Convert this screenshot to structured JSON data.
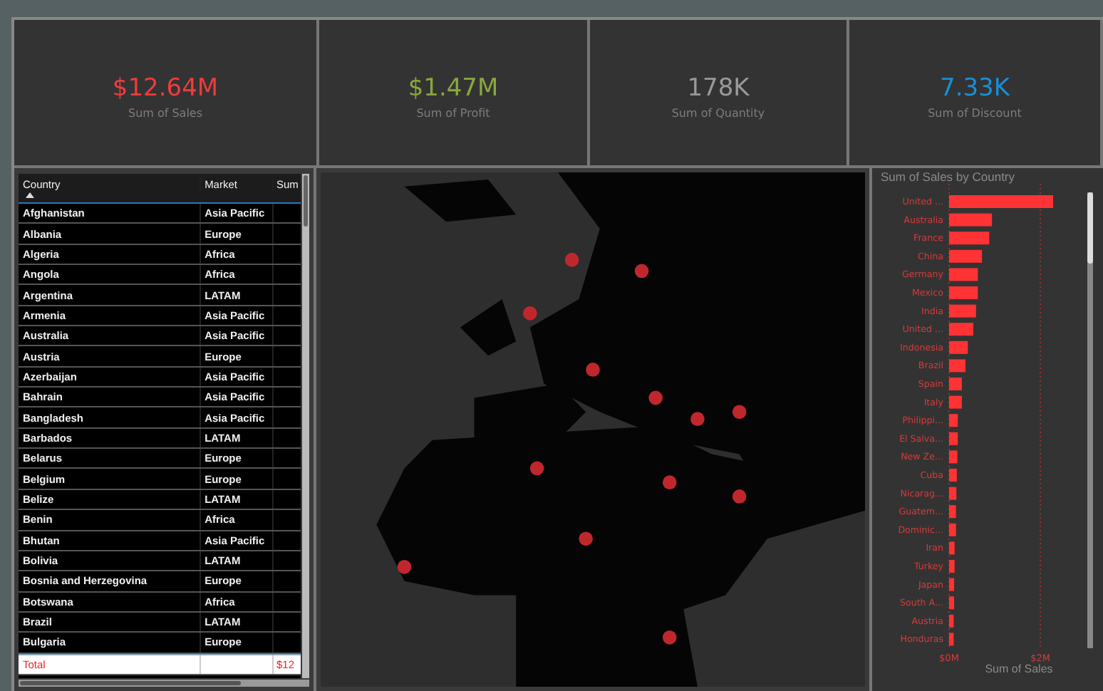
{
  "cards": [
    {
      "value": "$12.64M",
      "label": "Sum of Sales",
      "color": "#f03c3c"
    },
    {
      "value": "$1.47M",
      "label": "Sum of Profit",
      "color": "#8aa83c"
    },
    {
      "value": "178K",
      "label": "Sum of Quantity",
      "color": "#9a9a9a"
    },
    {
      "value": "7.33K",
      "label": "Sum of Discount",
      "color": "#1a8fd6"
    }
  ],
  "table": {
    "columns": [
      "Country",
      "Market",
      "Sum"
    ],
    "rows": [
      [
        "Afghanistan",
        "Asia Pacific"
      ],
      [
        "Albania",
        "Europe"
      ],
      [
        "Algeria",
        "Africa"
      ],
      [
        "Angola",
        "Africa"
      ],
      [
        "Argentina",
        "LATAM"
      ],
      [
        "Armenia",
        "Asia Pacific"
      ],
      [
        "Australia",
        "Asia Pacific"
      ],
      [
        "Austria",
        "Europe"
      ],
      [
        "Azerbaijan",
        "Asia Pacific"
      ],
      [
        "Bahrain",
        "Asia Pacific"
      ],
      [
        "Bangladesh",
        "Asia Pacific"
      ],
      [
        "Barbados",
        "LATAM"
      ],
      [
        "Belarus",
        "Europe"
      ],
      [
        "Belgium",
        "Europe"
      ],
      [
        "Belize",
        "LATAM"
      ],
      [
        "Benin",
        "Africa"
      ],
      [
        "Bhutan",
        "Asia Pacific"
      ],
      [
        "Bolivia",
        "LATAM"
      ],
      [
        "Bosnia and Herzegovina",
        "Europe"
      ],
      [
        "Botswana",
        "Africa"
      ],
      [
        "Brazil",
        "LATAM"
      ],
      [
        "Bulgaria",
        "Europe"
      ]
    ],
    "total": {
      "label": "Total",
      "sum": "$12"
    }
  },
  "chart": {
    "chart_data": {
      "type": "bar",
      "orientation": "horizontal",
      "title": "Sum of Sales by Country",
      "xlabel": "Sum of Sales",
      "categories": [
        "United ...",
        "Australia",
        "France",
        "China",
        "Germany",
        "Mexico",
        "India",
        "United ...",
        "Indonesia",
        "Brazil",
        "Spain",
        "Italy",
        "Philippi...",
        "El Salva...",
        "New Ze...",
        "Cuba",
        "Nicarag...",
        "Guatem...",
        "Dominic...",
        "Iran",
        "Turkey",
        "Japan",
        "South A...",
        "Austria",
        "Honduras"
      ],
      "series": [
        {
          "color": "#ff3333",
          "values": [
            2.28,
            0.94,
            0.88,
            0.72,
            0.63,
            0.63,
            0.59,
            0.53,
            0.41,
            0.36,
            0.28,
            0.28,
            0.19,
            0.19,
            0.18,
            0.17,
            0.16,
            0.15,
            0.15,
            0.12,
            0.12,
            0.11,
            0.11,
            0.1,
            0.1
          ]
        }
      ],
      "xlim": [
        0,
        2.28
      ],
      "xticks": [
        {
          "value": 0,
          "label": "$0M"
        },
        {
          "value": 2,
          "label": "$2M"
        }
      ]
    }
  }
}
